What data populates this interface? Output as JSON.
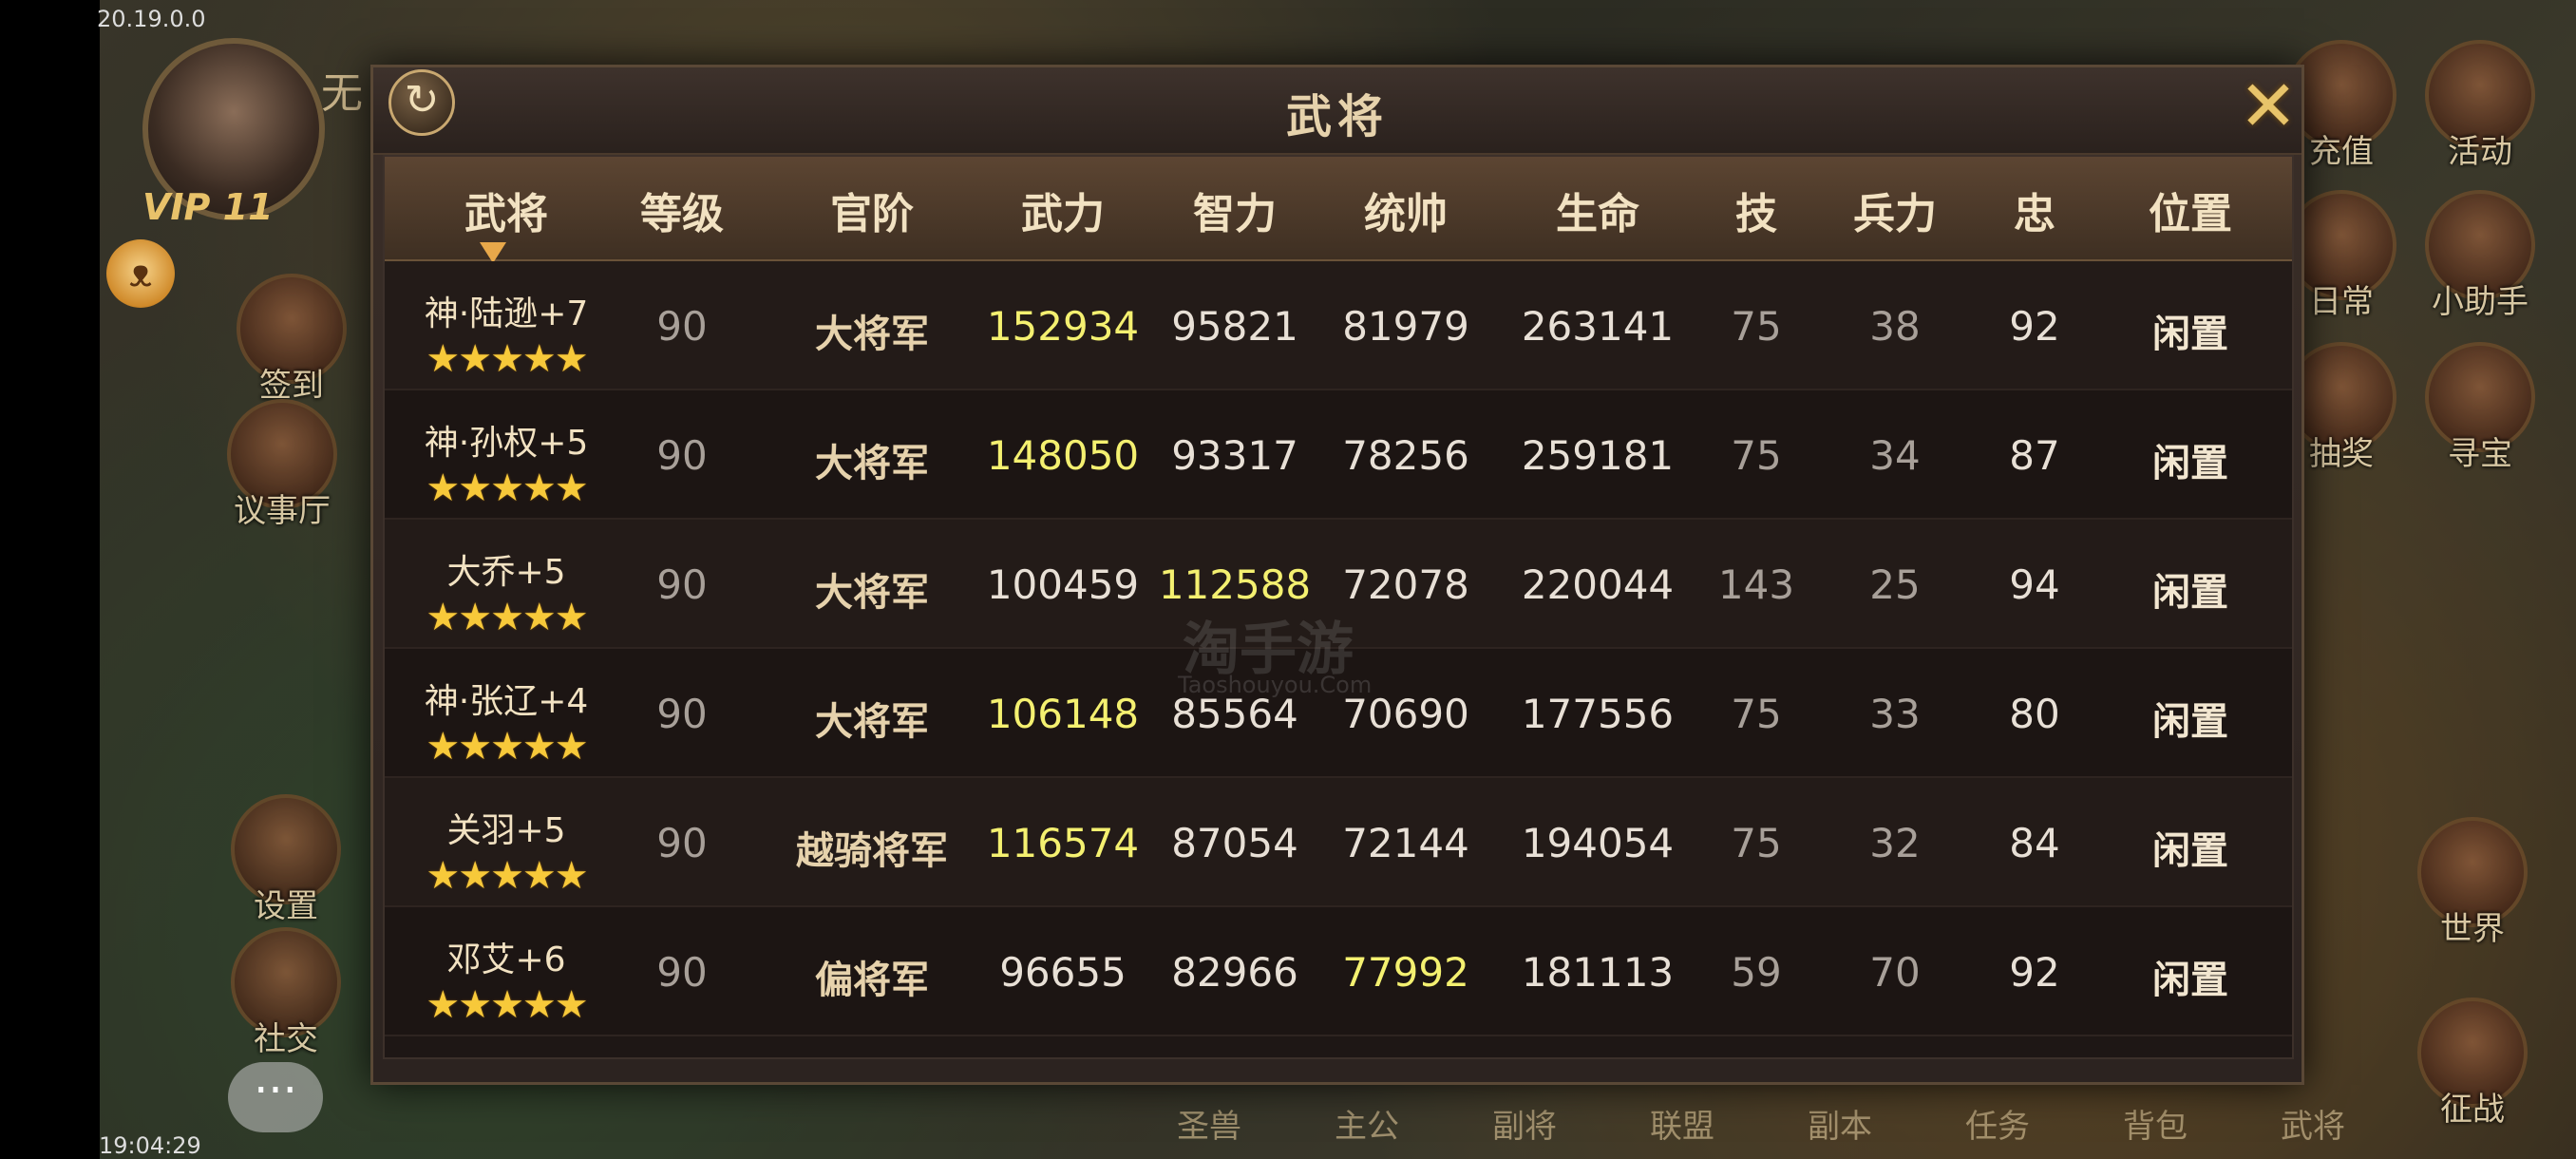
{
  "status_bar": {
    "version": "20.19.0.0",
    "time": "19:04:29"
  },
  "player": {
    "name": "无",
    "vip": "VIP 11"
  },
  "side_menu_left": [
    {
      "label": "签到",
      "icon": "checkin-icon"
    },
    {
      "label": "议事厅",
      "icon": "hall-icon"
    },
    {
      "label": "设置",
      "icon": "settings-icon"
    },
    {
      "label": "社交",
      "icon": "social-icon"
    }
  ],
  "side_menu_right": [
    {
      "label": "充值",
      "icon": "recharge-icon"
    },
    {
      "label": "活动",
      "icon": "gift-icon"
    },
    {
      "label": "日常",
      "icon": "daily-icon"
    },
    {
      "label": "小助手",
      "icon": "helper-icon"
    },
    {
      "label": "抽奖",
      "icon": "lottery-icon"
    },
    {
      "label": "寻宝",
      "icon": "treasure-icon"
    },
    {
      "label": "世界",
      "icon": "world-icon"
    },
    {
      "label": "征战",
      "icon": "battle-icon"
    }
  ],
  "bottom_nav": [
    "圣兽",
    "主公",
    "副将",
    "联盟",
    "副本",
    "任务",
    "背包",
    "武将"
  ],
  "panel": {
    "title": "武将",
    "watermark": "淘手游",
    "watermark_url": "Taoshouyou.Com",
    "columns": [
      "武将",
      "等级",
      "官阶",
      "武力",
      "智力",
      "统帅",
      "生命",
      "技",
      "兵力",
      "忠",
      "位置"
    ],
    "rows": [
      {
        "name": "神·陆逊",
        "plus": "+7",
        "stars": 5,
        "level": "90",
        "rank": "大将军",
        "force": "152934",
        "intel": "95821",
        "command": "81979",
        "life": "263141",
        "skill": "75",
        "troops": "38",
        "loyalty": "92",
        "position": "闲置",
        "highlight": "force"
      },
      {
        "name": "神·孙权",
        "plus": "+5",
        "stars": 5,
        "level": "90",
        "rank": "大将军",
        "force": "148050",
        "intel": "93317",
        "command": "78256",
        "life": "259181",
        "skill": "75",
        "troops": "34",
        "loyalty": "87",
        "position": "闲置",
        "highlight": "force"
      },
      {
        "name": "大乔",
        "plus": "+5",
        "stars": 5,
        "level": "90",
        "rank": "大将军",
        "force": "100459",
        "intel": "112588",
        "command": "72078",
        "life": "220044",
        "skill": "143",
        "troops": "25",
        "loyalty": "94",
        "position": "闲置",
        "highlight": "intel"
      },
      {
        "name": "神·张辽",
        "plus": "+4",
        "stars": 5,
        "level": "90",
        "rank": "大将军",
        "force": "106148",
        "intel": "85564",
        "command": "70690",
        "life": "177556",
        "skill": "75",
        "troops": "33",
        "loyalty": "80",
        "position": "闲置",
        "highlight": "force"
      },
      {
        "name": "关羽",
        "plus": "+5",
        "stars": 5,
        "level": "90",
        "rank": "越骑将军",
        "force": "116574",
        "intel": "87054",
        "command": "72144",
        "life": "194054",
        "skill": "75",
        "troops": "32",
        "loyalty": "84",
        "position": "闲置",
        "highlight": "force"
      },
      {
        "name": "邓艾",
        "plus": "+6",
        "stars": 5,
        "level": "90",
        "rank": "偏将军",
        "force": "96655",
        "intel": "82966",
        "command": "77992",
        "life": "181113",
        "skill": "59",
        "troops": "70",
        "loyalty": "92",
        "position": "闲置",
        "highlight": "command"
      }
    ]
  },
  "colors": {
    "highlight": "#f4f070",
    "header_bg": "#5c4532",
    "panel_bg": "#2c2320",
    "star": "#f7c93a"
  }
}
